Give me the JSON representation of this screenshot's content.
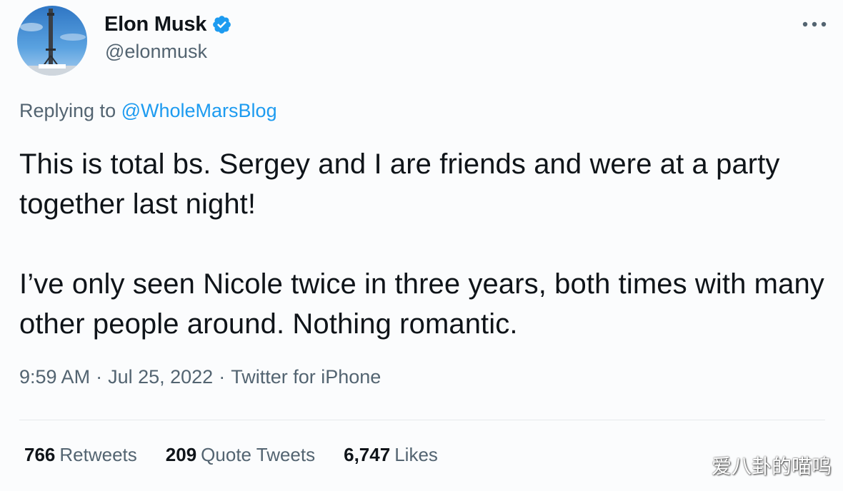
{
  "author": {
    "display_name": "Elon Musk",
    "handle": "@elonmusk",
    "verified": true
  },
  "reply": {
    "prefix": "Replying to",
    "mention": "@WholeMarsBlog"
  },
  "tweet": {
    "paragraphs": [
      "This is total bs. Sergey and I are friends and were at a party together last night!",
      "I’ve only seen Nicole twice in three years, both times with many other people around. Nothing romantic."
    ]
  },
  "meta": {
    "time": "9:59 AM",
    "date": "Jul 25, 2022",
    "source": "Twitter for iPhone",
    "separator": "·"
  },
  "stats": {
    "retweets": {
      "count": "766",
      "label": "Retweets"
    },
    "quotes": {
      "count": "209",
      "label": "Quote Tweets"
    },
    "likes": {
      "count": "6,747",
      "label": "Likes"
    }
  },
  "watermark": "爱八卦的喵呜",
  "icons": {
    "verified": "verified-badge-icon",
    "more": "more-options-icon"
  },
  "colors": {
    "accent": "#1d9bf0",
    "secondary_text": "#536471",
    "primary_text": "#0f1419"
  }
}
